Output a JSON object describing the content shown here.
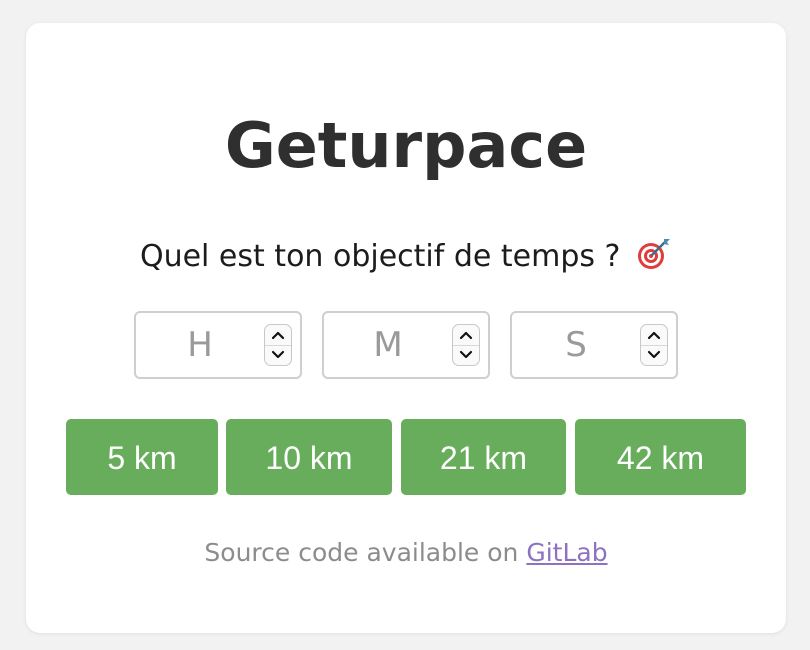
{
  "app": {
    "title": "Geturpace",
    "question": "Quel est ton objectif de temps ?",
    "question_icon": "target-dart-icon"
  },
  "time_inputs": [
    {
      "placeholder": "H",
      "value": ""
    },
    {
      "placeholder": "M",
      "value": ""
    },
    {
      "placeholder": "S",
      "value": ""
    }
  ],
  "distance_buttons": [
    {
      "label": "5 km"
    },
    {
      "label": "10 km"
    },
    {
      "label": "21 km"
    },
    {
      "label": "42 km"
    }
  ],
  "footer": {
    "text": "Source code available on ",
    "link_label": "GitLab"
  },
  "colors": {
    "button_green": "#67ad5b",
    "link_purple": "#8e72c0",
    "title_dark": "#2f2f2f",
    "background": "#f2f2f2"
  }
}
